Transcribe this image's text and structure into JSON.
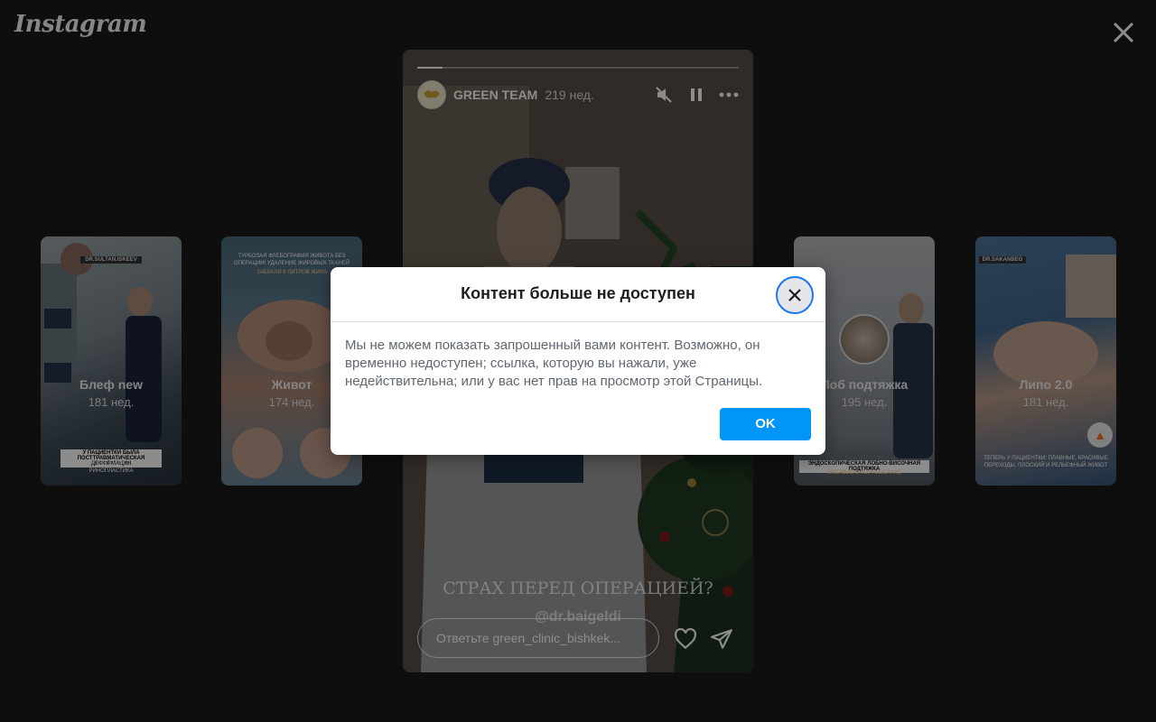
{
  "app": {
    "logo_text": "Instagram"
  },
  "thumbnails": [
    {
      "title": "Блеф new",
      "age": "181 нед.",
      "tag": "DR.SULTAN.ISKEEV",
      "box_text": "У ПАЦИЕНТКИ БЫЛА ПОСТТРАВМАТИЧЕСКАЯ ДЕФОРМАЦИЯ",
      "bottom_text": "И РАНЕЕ ЕЙ УЖЕ БЫЛА ПРОВЕДЕНА РИНОПЛАСТИКА"
    },
    {
      "title": "Живот",
      "age": "174 нед.",
      "top_text": "ТУРБОЗАЯ ФЛЕБОГРАФИЯ ЖИВОТА БЕЗ ОПЕРАЦИИ! УДАЛЕНИЕ ЖИРОВЫХ ТКАНЕЙ",
      "sub_text": "ЗАБРАЛИ 6 ЛИТРОВ ЖИРА"
    },
    {
      "title": "Лоб подтяжка",
      "age": "195 нед.",
      "box_text": "ЭНДОСКОПИЧЕСКАЯ ЛОБНО-ВИСОЧНАЯ ПОДТЯЖКА",
      "bottom_text": "ВПЕРВЫЕ В КЫРГЫЗСТАНЕ"
    },
    {
      "title": "Липо 2.0",
      "age": "181 нед.",
      "tag": "DR.SAKANBEG",
      "bottom_text": "ТЕПЕРЬ У ПАЦИЕНТКИ: ПЛАВНЫЕ, КРАСИВЫЕ ПЕРЕХОДЫ, ПЛОСКИЙ И РЕЛЬЕФНЫЙ ЖИВОТ"
    }
  ],
  "story": {
    "username": "GREEN TEAM",
    "time": "219 нед.",
    "progress": 0.08,
    "caption": "СТРАХ ПЕРЕД ОПЕРАЦИЕЙ?",
    "handle": "@dr.baigeldi",
    "reply_placeholder": "Ответьте green_clinic_bishkek..."
  },
  "dialog": {
    "title": "Контент больше не доступен",
    "message": "Мы не можем показать запрошенный вами контент. Возможно, он временно недоступен; ссылка, которую вы нажали, уже недействительна; или у вас нет прав на просмотр этой Страницы.",
    "ok_label": "OK"
  }
}
